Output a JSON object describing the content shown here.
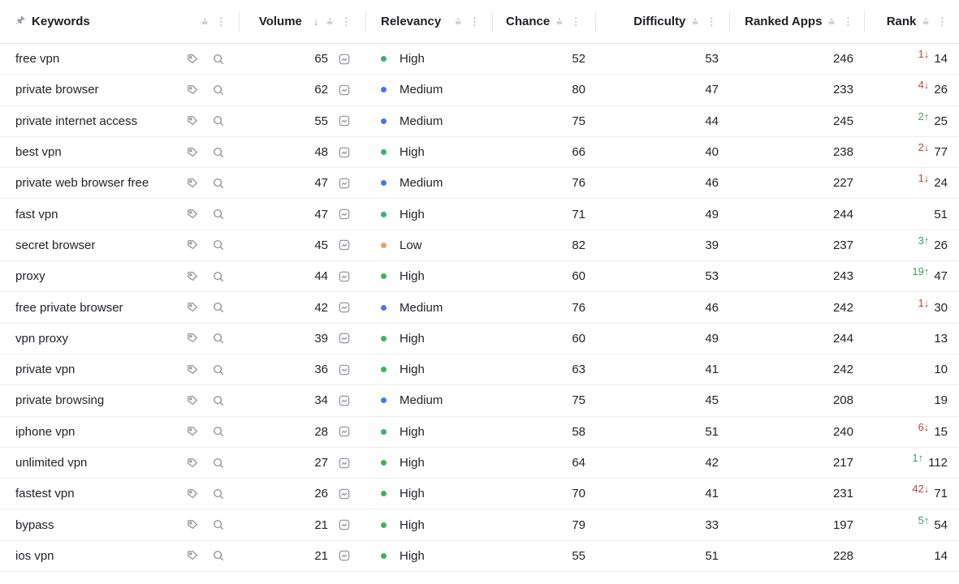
{
  "colors": {
    "high": "#3cb16a",
    "medium": "#4c74ef",
    "low": "#e9a06a",
    "up": "#3e9a66",
    "down": "#b2473f"
  },
  "icons": {
    "pin": "pin-icon",
    "filter": "filter-icon",
    "more": "more-vertical-icon",
    "sort": "sort-down-arrow-icon",
    "tag": "tag-icon",
    "search": "search-icon",
    "chart": "trend-chart-icon"
  },
  "columns": {
    "keywords": "Keywords",
    "volume": "Volume",
    "relevancy": "Relevancy",
    "chance": "Chance",
    "difficulty": "Difficulty",
    "ranked_apps": "Ranked Apps",
    "rank": "Rank"
  },
  "rows": [
    {
      "keyword": "free vpn",
      "volume": "65",
      "relevancy": "High",
      "chance": "52",
      "difficulty": "53",
      "ranked_apps": "246",
      "rank_change": "1↓",
      "rank_dir": "down",
      "rank": "14"
    },
    {
      "keyword": "private browser",
      "volume": "62",
      "relevancy": "Medium",
      "chance": "80",
      "difficulty": "47",
      "ranked_apps": "233",
      "rank_change": "4↓",
      "rank_dir": "down",
      "rank": "26"
    },
    {
      "keyword": "private internet access",
      "volume": "55",
      "relevancy": "Medium",
      "chance": "75",
      "difficulty": "44",
      "ranked_apps": "245",
      "rank_change": "2↑",
      "rank_dir": "up",
      "rank": "25"
    },
    {
      "keyword": "best vpn",
      "volume": "48",
      "relevancy": "High",
      "chance": "66",
      "difficulty": "40",
      "ranked_apps": "238",
      "rank_change": "2↓",
      "rank_dir": "down",
      "rank": "77"
    },
    {
      "keyword": "private web browser free",
      "volume": "47",
      "relevancy": "Medium",
      "chance": "76",
      "difficulty": "46",
      "ranked_apps": "227",
      "rank_change": "1↓",
      "rank_dir": "down",
      "rank": "24"
    },
    {
      "keyword": "fast vpn",
      "volume": "47",
      "relevancy": "High",
      "chance": "71",
      "difficulty": "49",
      "ranked_apps": "244",
      "rank_change": "",
      "rank_dir": "",
      "rank": "51"
    },
    {
      "keyword": "secret browser",
      "volume": "45",
      "relevancy": "Low",
      "chance": "82",
      "difficulty": "39",
      "ranked_apps": "237",
      "rank_change": "3↑",
      "rank_dir": "up",
      "rank": "26"
    },
    {
      "keyword": "proxy",
      "volume": "44",
      "relevancy": "High",
      "chance": "60",
      "difficulty": "53",
      "ranked_apps": "243",
      "rank_change": "19↑",
      "rank_dir": "up",
      "rank": "47"
    },
    {
      "keyword": "free private browser",
      "volume": "42",
      "relevancy": "Medium",
      "chance": "76",
      "difficulty": "46",
      "ranked_apps": "242",
      "rank_change": "1↓",
      "rank_dir": "down",
      "rank": "30"
    },
    {
      "keyword": "vpn proxy",
      "volume": "39",
      "relevancy": "High",
      "chance": "60",
      "difficulty": "49",
      "ranked_apps": "244",
      "rank_change": "",
      "rank_dir": "",
      "rank": "13"
    },
    {
      "keyword": "private vpn",
      "volume": "36",
      "relevancy": "High",
      "chance": "63",
      "difficulty": "41",
      "ranked_apps": "242",
      "rank_change": "",
      "rank_dir": "",
      "rank": "10"
    },
    {
      "keyword": "private browsing",
      "volume": "34",
      "relevancy": "Medium",
      "chance": "75",
      "difficulty": "45",
      "ranked_apps": "208",
      "rank_change": "",
      "rank_dir": "",
      "rank": "19"
    },
    {
      "keyword": "iphone vpn",
      "volume": "28",
      "relevancy": "High",
      "chance": "58",
      "difficulty": "51",
      "ranked_apps": "240",
      "rank_change": "6↓",
      "rank_dir": "down",
      "rank": "15"
    },
    {
      "keyword": "unlimited vpn",
      "volume": "27",
      "relevancy": "High",
      "chance": "64",
      "difficulty": "42",
      "ranked_apps": "217",
      "rank_change": "1↑",
      "rank_dir": "up",
      "rank": "112"
    },
    {
      "keyword": "fastest vpn",
      "volume": "26",
      "relevancy": "High",
      "chance": "70",
      "difficulty": "41",
      "ranked_apps": "231",
      "rank_change": "42↓",
      "rank_dir": "down",
      "rank": "71"
    },
    {
      "keyword": "bypass",
      "volume": "21",
      "relevancy": "High",
      "chance": "79",
      "difficulty": "33",
      "ranked_apps": "197",
      "rank_change": "5↑",
      "rank_dir": "up",
      "rank": "54"
    },
    {
      "keyword": "ios vpn",
      "volume": "21",
      "relevancy": "High",
      "chance": "55",
      "difficulty": "51",
      "ranked_apps": "228",
      "rank_change": "",
      "rank_dir": "",
      "rank": "14"
    }
  ]
}
